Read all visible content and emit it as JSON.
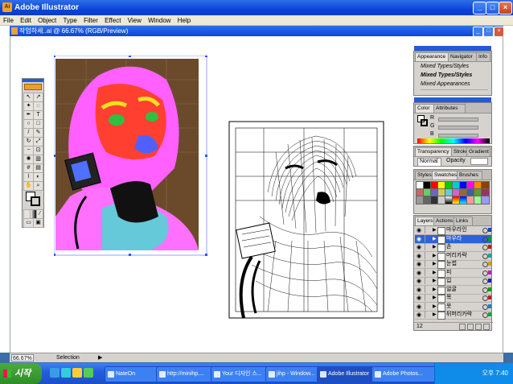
{
  "app": {
    "title": "Adobe Illustrator",
    "logo": "Ai"
  },
  "window_buttons": {
    "min": "_",
    "max": "□",
    "close": "×"
  },
  "menu": [
    "File",
    "Edit",
    "Object",
    "Type",
    "Filter",
    "Effect",
    "View",
    "Window",
    "Help"
  ],
  "document": {
    "title": "작업하세..ai @ 66.67% (RGB/Preview)"
  },
  "panels": {
    "appearance": {
      "tabs": [
        "Appearance",
        "Navigator",
        "Info"
      ],
      "rows": [
        "Mixed Types/Styles",
        "Mixed Types/Styles",
        "Mixed Appearances"
      ]
    },
    "color": {
      "tabs": [
        "Color",
        "Attributes"
      ],
      "channels": [
        "R",
        "G",
        "B"
      ]
    },
    "transparency": {
      "tabs": [
        "Transparency",
        "Stroke",
        "Gradient"
      ],
      "mode": "Normal",
      "opacity_label": "Opacity"
    },
    "swatches": {
      "tabs": [
        "Styles",
        "Swatches",
        "Brushes"
      ]
    },
    "layers": {
      "tabs": [
        "Layers",
        "Actions",
        "Links"
      ],
      "count": "12",
      "items": [
        {
          "name": "마우라인",
          "color": "#2040c0"
        },
        {
          "name": "마우라",
          "color": "#00a000",
          "selected": true
        },
        {
          "name": "손",
          "color": "#c02020"
        },
        {
          "name": "머리카락",
          "color": "#20a0a0"
        },
        {
          "name": "눈썹",
          "color": "#d0a000"
        },
        {
          "name": "피",
          "color": "#c020c0"
        },
        {
          "name": "입",
          "color": "#2020c0"
        },
        {
          "name": "얼굴",
          "color": "#00a000"
        },
        {
          "name": "목",
          "color": "#c02020"
        },
        {
          "name": "옷",
          "color": "#2080c0"
        },
        {
          "name": "뒤머리카락",
          "color": "#20a040"
        }
      ]
    }
  },
  "status": {
    "zoom": "66.67%",
    "mode": "Selection"
  },
  "taskbar": {
    "start": "시작",
    "tasks": [
      "NateOn",
      "http://minihp....",
      "Your 디자인 스...",
      "jihp - Window...",
      "Adobe Illustrator",
      "Adobe Photos..."
    ],
    "active_task": "Adobe Illustrator",
    "clock": "오후 7:40"
  },
  "colors": {
    "title_blue": "#0a46d8",
    "taskbar_blue": "#245edb",
    "start_green": "#2f8d2a",
    "panel_gray": "#d6d3ce"
  }
}
